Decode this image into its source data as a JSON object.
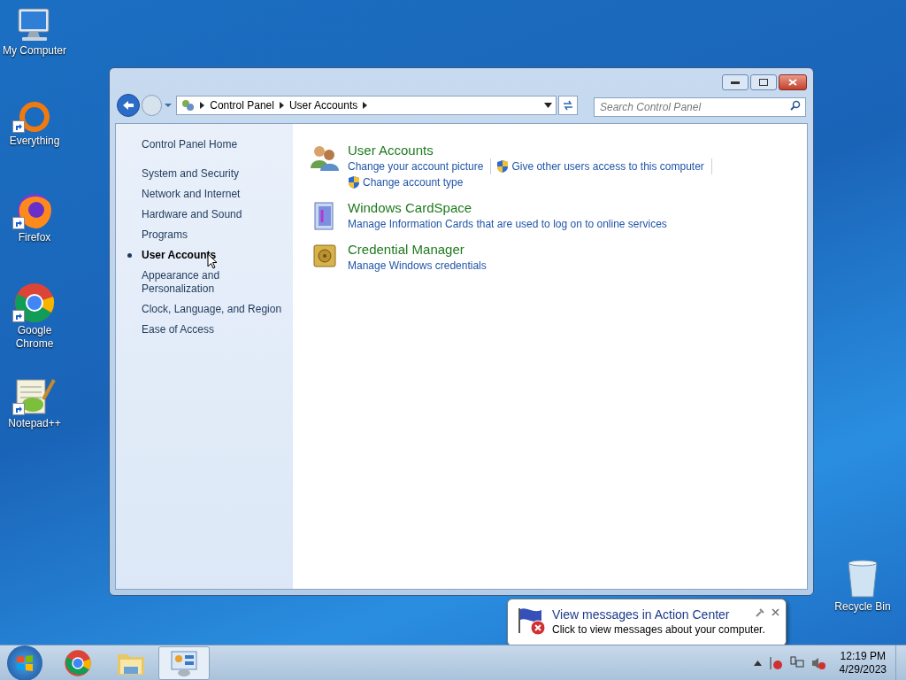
{
  "desktop_icons": [
    {
      "label": "My Computer",
      "shortcut": false
    },
    {
      "label": "Everything",
      "shortcut": true
    },
    {
      "label": "Firefox",
      "shortcut": true
    },
    {
      "label": "Google Chrome",
      "shortcut": true
    },
    {
      "label": "Notepad++",
      "shortcut": true
    }
  ],
  "recycle_bin": {
    "label": "Recycle Bin"
  },
  "window": {
    "breadcrumbs": [
      "Control Panel",
      "User Accounts"
    ],
    "search": {
      "placeholder": "Search Control Panel"
    }
  },
  "sidebar": {
    "home": "Control Panel Home",
    "items": [
      {
        "label": "System and Security",
        "selected": false
      },
      {
        "label": "Network and Internet",
        "selected": false
      },
      {
        "label": "Hardware and Sound",
        "selected": false
      },
      {
        "label": "Programs",
        "selected": false
      },
      {
        "label": "User Accounts",
        "selected": true
      },
      {
        "label": "Appearance and\nPersonalization",
        "selected": false
      },
      {
        "label": "Clock, Language, and Region",
        "selected": false
      },
      {
        "label": "Ease of Access",
        "selected": false
      }
    ]
  },
  "categories": [
    {
      "title": "User Accounts",
      "links": [
        {
          "text": "Change your account picture",
          "shield": false
        },
        {
          "text": "Give other users access to this computer",
          "shield": true
        },
        {
          "text": "Change account type",
          "shield": true
        }
      ]
    },
    {
      "title": "Windows CardSpace",
      "links": [
        {
          "text": "Manage Information Cards that are used to log on to online services",
          "shield": false
        }
      ]
    },
    {
      "title": "Credential Manager",
      "links": [
        {
          "text": "Manage Windows credentials",
          "shield": false
        }
      ]
    }
  ],
  "notification": {
    "title": "View messages in Action Center",
    "text": "Click to view messages about your computer."
  },
  "taskbar": {
    "buttons": [
      {
        "selected": false
      },
      {
        "selected": false
      },
      {
        "selected": true
      }
    ]
  },
  "clock": {
    "time": "12:19 PM",
    "date": "4/29/2023"
  }
}
